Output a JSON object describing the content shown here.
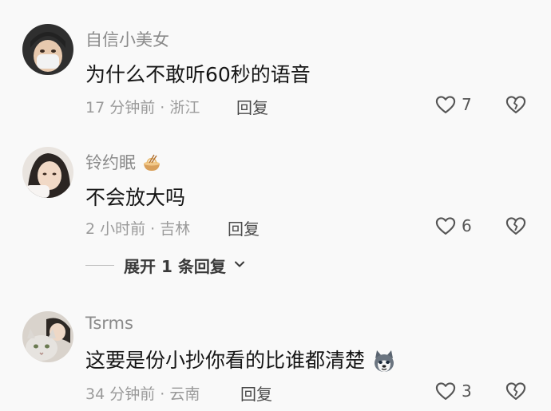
{
  "comments": [
    {
      "username": "自信小美女",
      "text": "为什么不敢听60秒的语音",
      "meta": "17 分钟前 · 浙江",
      "reply_label": "回复",
      "likes": "7",
      "avatar": "avatar-masked-person"
    },
    {
      "username": "铃约眠",
      "username_emoji": "noodle-bowl-icon",
      "text": "不会放大吗",
      "meta": "2 小时前 · 吉林",
      "reply_label": "回复",
      "likes": "6",
      "avatar": "avatar-girl"
    },
    {
      "username": "Tsrms",
      "text": "这要是份小抄你看的比谁都清楚",
      "text_emoji": "husky-dog-icon",
      "meta": "34 分钟前 · 云南",
      "reply_label": "回复",
      "likes": "3",
      "avatar": "avatar-cat"
    }
  ],
  "expand_replies": {
    "label": "展开 1 条回复"
  },
  "colors": {
    "background": "#f9f9f9",
    "text": "#161616",
    "meta": "#9a9a9a"
  }
}
